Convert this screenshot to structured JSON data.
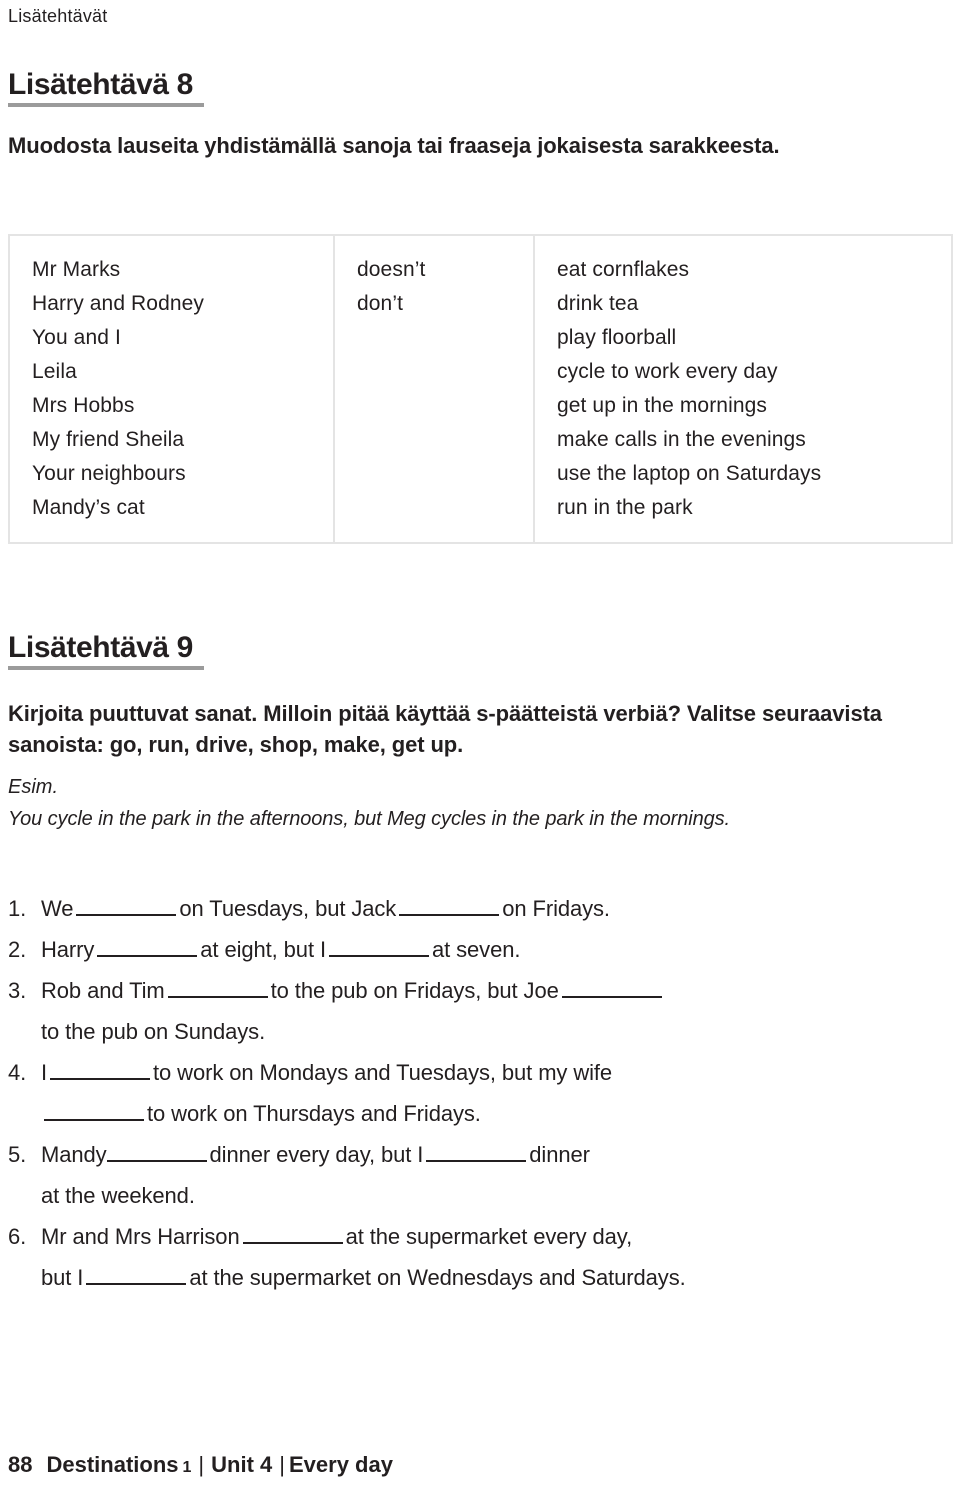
{
  "running_head": "Lisätehtävät",
  "sections": [
    {
      "heading": "Lisätehtävä 8",
      "instruction": "Muodosta lauseita yhdistämällä sanoja tai fraaseja jokaisesta sarakkeesta."
    },
    {
      "heading": "Lisätehtävä 9",
      "instruction": "Kirjoita puuttuvat sanat. Milloin pitää käyttää s-päätteistä verbiä? Valitse seuraavista sanoista: go, run, drive, shop, make, get up.",
      "example_label": "Esim.",
      "example_sentence": "You cycle in the park in the afternoons, but Meg cycles in the park in the mornings."
    }
  ],
  "word_table": {
    "columns": [
      {
        "items": [
          "Mr Marks",
          "Harry and Rodney",
          "You and I",
          "Leila",
          "Mrs Hobbs",
          "My friend Sheila",
          "Your neighbours",
          "Mandy’s cat"
        ]
      },
      {
        "items": [
          "doesn’t",
          "don’t"
        ]
      },
      {
        "items": [
          "eat cornflakes",
          "drink tea",
          "play floorball",
          "cycle to work every day",
          "get up in the mornings",
          "make calls in the evenings",
          "use the laptop on Saturdays",
          "run in the park"
        ]
      }
    ]
  },
  "exercises": [
    {
      "number": "1.",
      "line1_a": "We",
      "line1_b": "on Tuesdays, but Jack",
      "line1_c": "on Fridays."
    },
    {
      "number": "2.",
      "line1_a": "Harry",
      "line1_b": "at eight, but I",
      "line1_c": "at seven."
    },
    {
      "number": "3.",
      "line1_a": "Rob and Tim",
      "line1_b": "to the pub on Fridays, but Joe",
      "line1_c": "",
      "line2": "to the pub on Sundays."
    },
    {
      "number": "4.",
      "line1_a": "I",
      "line1_b": "to work on Mondays and Tuesdays, but my wife",
      "line2_b": "to work on Thursdays and Fridays."
    },
    {
      "number": "5.",
      "line1_a": "Mandy",
      "line1_b": "dinner every day, but I",
      "line1_c": "dinner",
      "line2": "at the weekend."
    },
    {
      "number": "6.",
      "line1_a": "Mr and Mrs Harrison",
      "line1_b": "at the supermarket every day,",
      "line2_a": "but I",
      "line2_b": "at the supermarket on Wednesdays and Saturdays."
    }
  ],
  "footer": {
    "page_number": "88",
    "book_title": "Destinations",
    "book_number": "1",
    "separator": "|",
    "unit": "Unit 4",
    "separator2": "|",
    "topic": "Every day"
  },
  "colors": {
    "text": "#231f20",
    "rule": "#9b9b9b",
    "table_border": "#e4e4e4"
  }
}
